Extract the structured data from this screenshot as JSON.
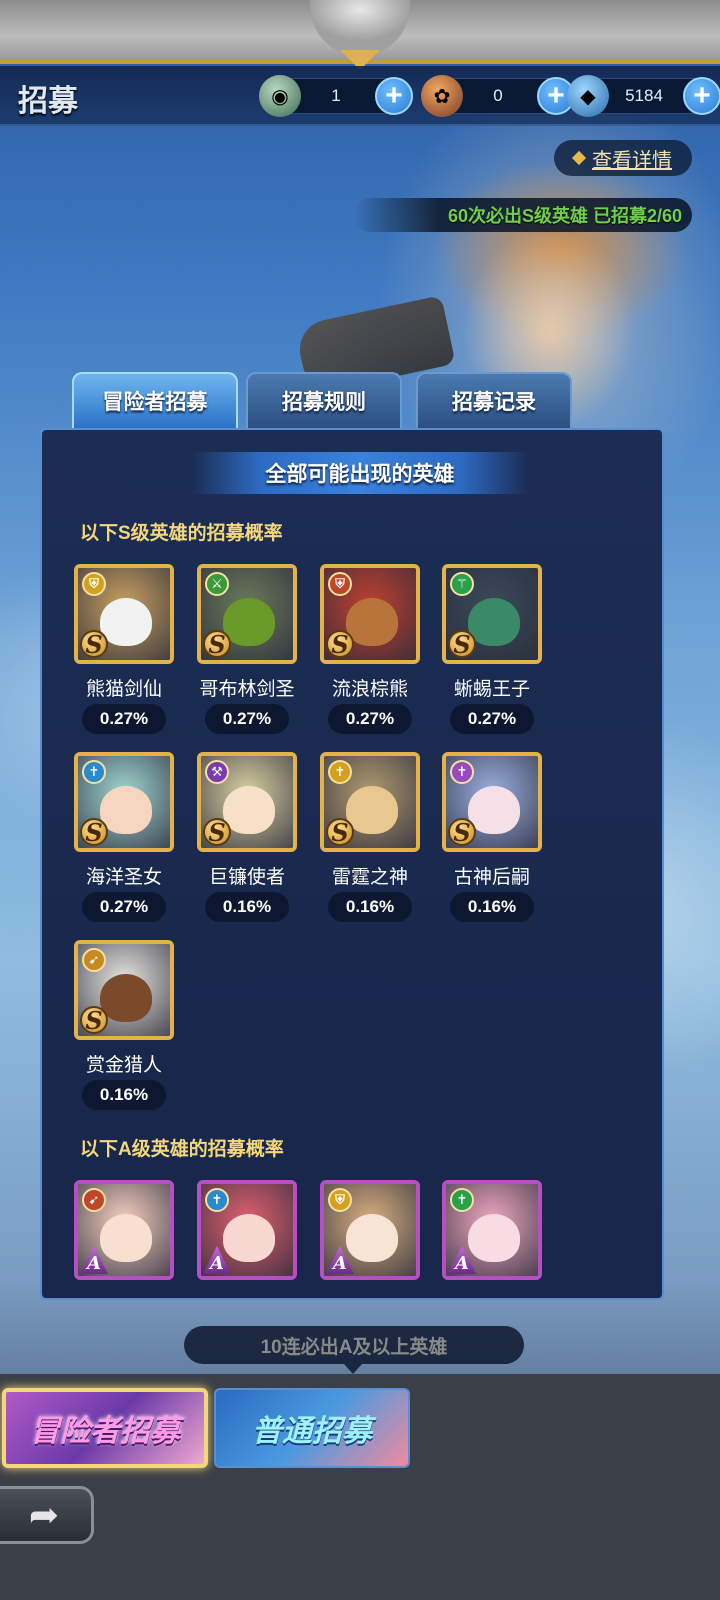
{
  "header": {
    "title": "招募",
    "resources": [
      {
        "icon": "gem-orb-icon",
        "value": "1"
      },
      {
        "icon": "flower-icon",
        "value": "0"
      },
      {
        "icon": "diamond-icon",
        "value": "5184"
      }
    ],
    "plus_label": "+"
  },
  "detail_button": {
    "label": "查看详情"
  },
  "pity": {
    "label": "60次必出S级英雄 已招募2/60"
  },
  "tabs": [
    {
      "label": "冒险者招募",
      "active": true
    },
    {
      "label": "招募规则",
      "active": false
    },
    {
      "label": "招募记录",
      "active": false
    }
  ],
  "panel": {
    "title": "全部可能出现的英雄",
    "s_section_label": "以下S级英雄的招募概率",
    "a_section_label": "以下A级英雄的招募概率",
    "s_heroes": [
      {
        "name": "熊猫剑仙",
        "rate": "0.27%",
        "rank": "S",
        "class_icon": "shield-icon",
        "class_color": "#d4a020",
        "bg": "#c8a060",
        "face": "#f2f2f2"
      },
      {
        "name": "哥布林剑圣",
        "rate": "0.27%",
        "rank": "S",
        "class_icon": "swords-icon",
        "class_color": "#3a9a3a",
        "bg": "#6a7a5a",
        "face": "#6a9a2a"
      },
      {
        "name": "流浪棕熊",
        "rate": "0.27%",
        "rank": "S",
        "class_icon": "shield-icon",
        "class_color": "#c0462a",
        "bg": "#c04030",
        "face": "#b8743a"
      },
      {
        "name": "蜥蜴王子",
        "rate": "0.27%",
        "rank": "S",
        "class_icon": "staff-icon",
        "class_color": "#2aa04a",
        "bg": "#3a4a5a",
        "face": "#3a8a6a"
      },
      {
        "name": "海洋圣女",
        "rate": "0.27%",
        "rank": "S",
        "class_icon": "cross-icon",
        "class_color": "#2a8ad0",
        "bg": "#a0d6d0",
        "face": "#f6d6c0"
      },
      {
        "name": "巨镰使者",
        "rate": "0.16%",
        "rank": "S",
        "class_icon": "scythe-icon",
        "class_color": "#7a3ab0",
        "bg": "#d8d0a0",
        "face": "#f6e0c8"
      },
      {
        "name": "雷霆之神",
        "rate": "0.16%",
        "rank": "S",
        "class_icon": "cross-icon",
        "class_color": "#d4a020",
        "bg": "#b09a70",
        "face": "#e8c890"
      },
      {
        "name": "古神后嗣",
        "rate": "0.16%",
        "rank": "S",
        "class_icon": "cross-icon",
        "class_color": "#9a4ac0",
        "bg": "#9ab0e0",
        "face": "#f6e0e8"
      },
      {
        "name": "赏金猎人",
        "rate": "0.16%",
        "rank": "S",
        "class_icon": "bow-icon",
        "class_color": "#c88a20",
        "bg": "#e8e6e0",
        "face": "#7a4a2a"
      }
    ],
    "a_heroes": [
      {
        "rank": "A",
        "class_icon": "bow-icon",
        "class_color": "#c0462a",
        "bg": "#f6d0c0",
        "face": "#f8e0d0"
      },
      {
        "rank": "A",
        "class_icon": "cross-icon",
        "class_color": "#2a8ad0",
        "bg": "#e06070",
        "face": "#f8d8d0"
      },
      {
        "rank": "A",
        "class_icon": "shield-icon",
        "class_color": "#d4a020",
        "bg": "#d8b080",
        "face": "#f8e4d4"
      },
      {
        "rank": "A",
        "class_icon": "cross-icon",
        "class_color": "#2aa04a",
        "bg": "#f0a8c0",
        "face": "#f8dce4"
      }
    ]
  },
  "guarantee": {
    "label": "10连必出A及以上英雄"
  },
  "pools": [
    {
      "label": "冒险者招募",
      "selected": true
    },
    {
      "label": "普通招募",
      "selected": false
    }
  ],
  "back_button": {
    "icon": "back-arrow-icon",
    "glyph": "➦"
  }
}
